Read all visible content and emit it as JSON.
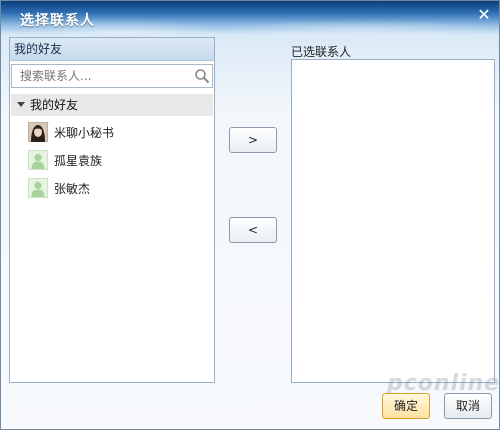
{
  "dialog": {
    "title": "选择联系人",
    "close_symbol": "✕"
  },
  "left": {
    "header": "我的好友",
    "search_placeholder": "搜索联系人...",
    "group": {
      "label": "我的好友",
      "expanded": true
    },
    "friends": [
      {
        "name": "米聊小秘书",
        "avatar": "photo-avatar-icon"
      },
      {
        "name": "孤星袁族",
        "avatar": "default-avatar-icon"
      },
      {
        "name": "张敏杰",
        "avatar": "default-avatar-icon"
      }
    ]
  },
  "right": {
    "label": "已选联系人"
  },
  "move": {
    "add_label": ">",
    "remove_label": "<"
  },
  "footer": {
    "ok_label": "确定",
    "cancel_label": "取消"
  },
  "watermark": "pconline",
  "colors": {
    "title_bar": "#2e6fb4",
    "border": "#98aec6",
    "ok_button": "#fde1a0"
  }
}
